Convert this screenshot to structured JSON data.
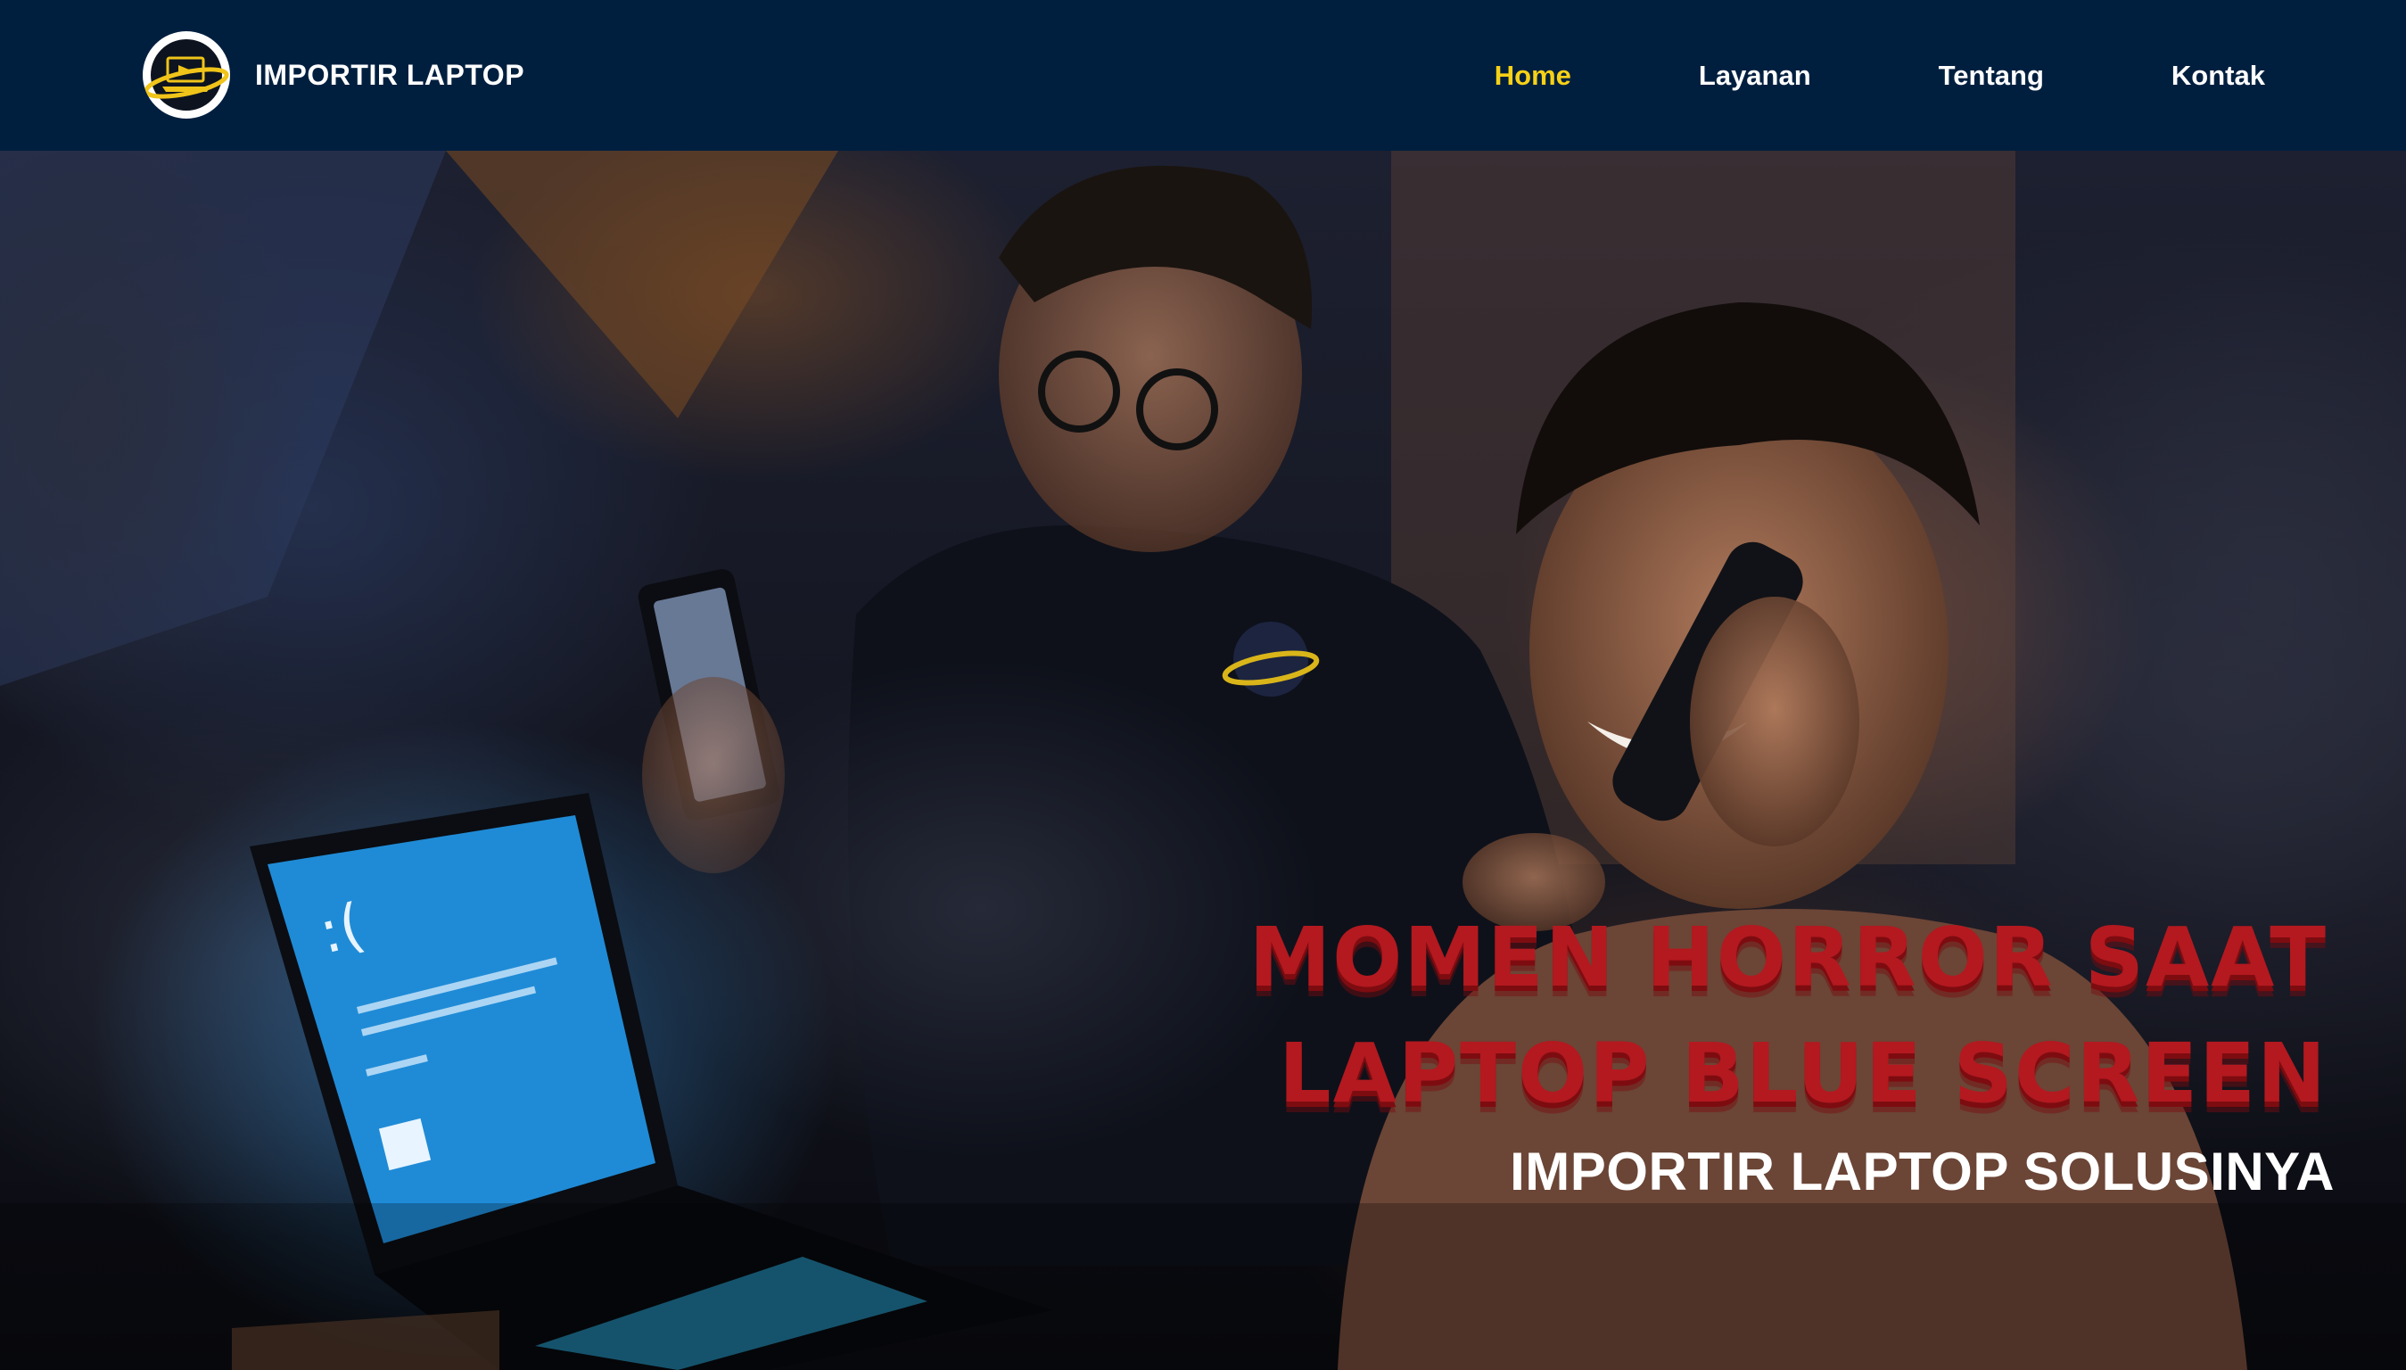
{
  "brand": {
    "name": "IMPORTIR LAPTOP",
    "logo_icon": "laptop-orbit-logo"
  },
  "nav": {
    "items": [
      {
        "label": "Home",
        "active": true
      },
      {
        "label": "Layanan",
        "active": false
      },
      {
        "label": "Tentang",
        "active": false
      },
      {
        "label": "Kontak",
        "active": false
      }
    ]
  },
  "hero": {
    "headline_line1": "MOMEN HORROR SAAT",
    "headline_line2": "LAPTOP BLUE SCREEN",
    "tagline": "IMPORTIR LAPTOP SOLUSINYA",
    "image_alt": "Two people with a laptop showing a blue screen error and a phone"
  },
  "colors": {
    "navbar_bg": "#001f3f",
    "nav_active": "#f7d117",
    "nav_text": "#ffffff",
    "headline_red": "#b3191f",
    "bsod_blue": "#1f8bd6"
  }
}
